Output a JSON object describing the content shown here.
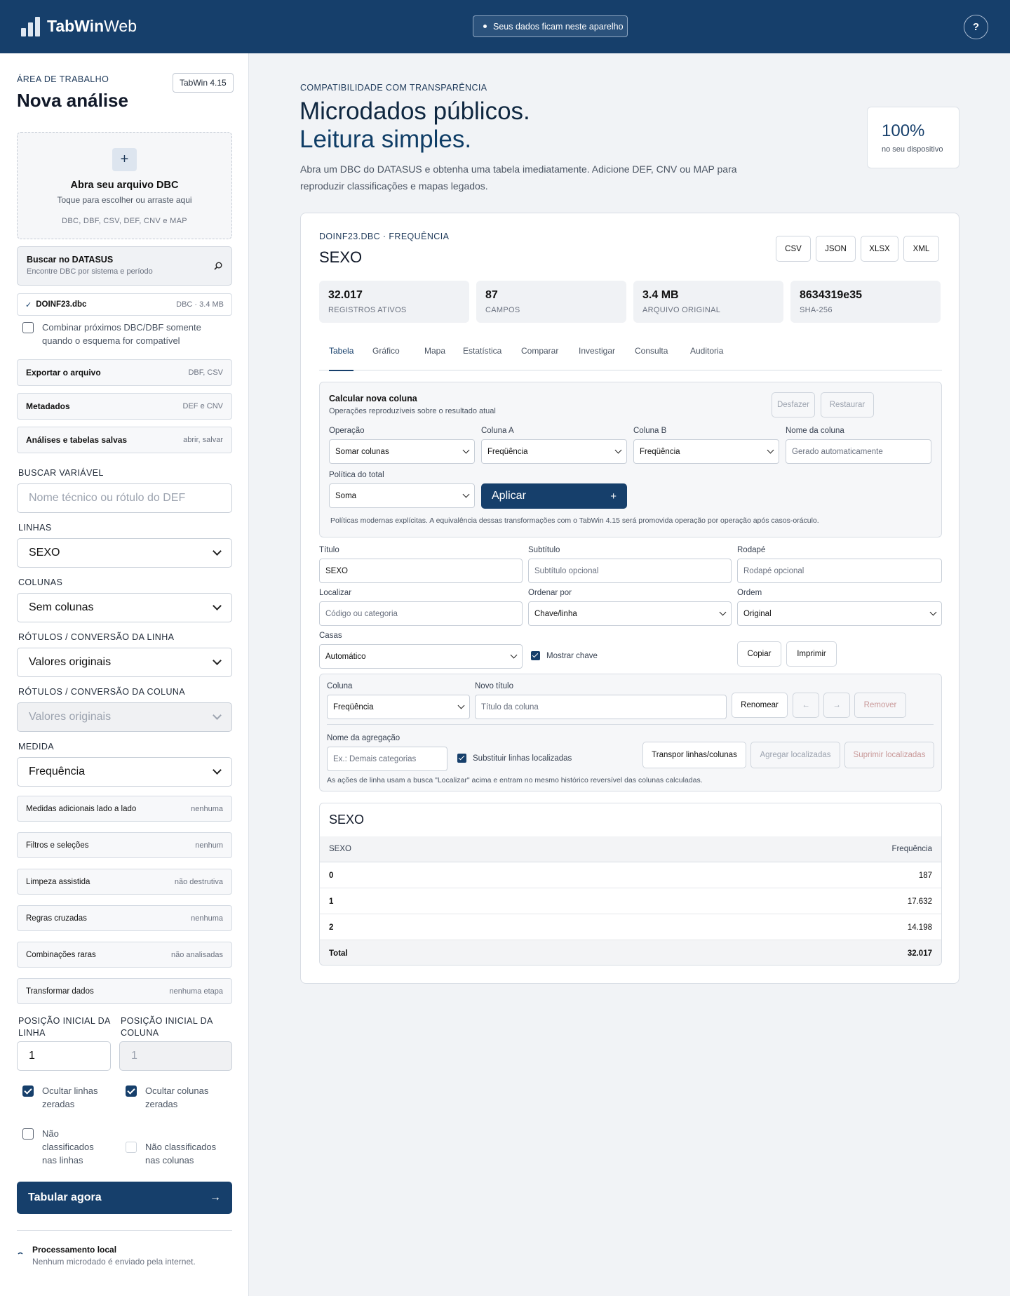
{
  "header": {
    "brand_bold": "TabWin",
    "brand_light": "Web",
    "privacy_text": "Seus dados ficam neste aparelho",
    "help_label": "?"
  },
  "sidebar": {
    "eyebrow": "ÁREA DE TRABALHO",
    "title": "Nova análise",
    "version": "TabWin 4.15",
    "dropzone": {
      "plus": "+",
      "title": "Abra seu arquivo DBC",
      "subtitle": "Toque para escolher ou arraste aqui",
      "formats": "DBC, DBF, CSV, DEF, CNV e MAP"
    },
    "datasus": {
      "title": "Buscar no DATASUS",
      "subtitle": "Encontre DBC por sistema e período"
    },
    "file": {
      "check": "✓",
      "name": "DOINF23.dbc",
      "meta": "DBC · 3.4 MB"
    },
    "combine_label": "Combinar próximos DBC/DBF somente quando o esquema for compatível",
    "sections": [
      {
        "label": "Exportar o arquivo",
        "value": "DBF, CSV"
      },
      {
        "label": "Metadados",
        "value": "DEF e CNV"
      },
      {
        "label": "Análises e tabelas salvas",
        "value": "abrir, salvar"
      }
    ],
    "search_var": {
      "label": "BUSCAR VARIÁVEL",
      "placeholder": "Nome técnico ou rótulo do DEF"
    },
    "rows": {
      "label": "LINHAS",
      "value": "SEXO"
    },
    "cols": {
      "label": "COLUNAS",
      "value": "Sem colunas"
    },
    "row_labels": {
      "label": "RÓTULOS / CONVERSÃO DA LINHA",
      "value": "Valores originais"
    },
    "col_labels": {
      "label": "RÓTULOS / CONVERSÃO DA COLUNA",
      "value": "Valores originais"
    },
    "measure": {
      "label": "MEDIDA",
      "value": "Frequência"
    },
    "extra_sections": [
      {
        "label": "Medidas adicionais lado a lado",
        "value": "nenhuma"
      },
      {
        "label": "Filtros e seleções",
        "value": "nenhum"
      },
      {
        "label": "Limpeza assistida",
        "value": "não destrutiva"
      },
      {
        "label": "Regras cruzadas",
        "value": "nenhuma"
      },
      {
        "label": "Combinações raras",
        "value": "não analisadas"
      },
      {
        "label": "Transformar dados",
        "value": "nenhuma etapa"
      }
    ],
    "start_row": {
      "label": "POSIÇÃO INICIAL DA LINHA",
      "value": "1"
    },
    "start_col": {
      "label": "POSIÇÃO INICIAL DA COLUNA",
      "value": "1"
    },
    "hide_zero_rows": "Ocultar linhas zeradas",
    "hide_zero_cols": "Ocultar colunas zeradas",
    "unclassified_rows": "Não classificados nas linhas",
    "unclassified_cols": "Não classificados nas colunas",
    "tabulate": {
      "label": "Tabular agora",
      "arrow": "→"
    },
    "local": {
      "title": "Processamento local",
      "subtitle": "Nenhum microdado é enviado pela internet."
    }
  },
  "hero": {
    "eyebrow": "COMPATIBILIDADE COM TRANSPARÊNCIA",
    "title_line1": "Microdados públicos.",
    "title_line2": "Leitura simples.",
    "description": "Abra um DBC do DATASUS e obtenha uma tabela imediatamente. Adicione DEF, CNV ou MAP para reproduzir classificações e mapas legados.",
    "stat_value": "100%",
    "stat_label": "no seu dispositivo"
  },
  "result": {
    "eyebrow": "DOINF23.DBC · FREQUÊNCIA",
    "title": "SEXO",
    "exports": [
      "CSV",
      "JSON",
      "XLSX",
      "XML"
    ],
    "stats": [
      {
        "value": "32.017",
        "label": "REGISTROS ATIVOS"
      },
      {
        "value": "87",
        "label": "CAMPOS"
      },
      {
        "value": "3.4 MB",
        "label": "ARQUIVO ORIGINAL"
      },
      {
        "value": "8634319e35",
        "label": "SHA-256"
      }
    ],
    "tabs": [
      "Tabela",
      "Gráfico",
      "Mapa",
      "Estatística",
      "Comparar",
      "Investigar",
      "Consulta",
      "Auditoria"
    ],
    "calc": {
      "title": "Calcular nova coluna",
      "subtitle": "Operações reproduzíveis sobre o resultado atual",
      "undo": "Desfazer",
      "restore": "Restaurar",
      "op_label": "Operação",
      "op_value": "Somar colunas",
      "cola_label": "Coluna A",
      "cola_value": "Freqüência",
      "colb_label": "Coluna B",
      "colb_value": "Freqüência",
      "name_label": "Nome da coluna",
      "name_placeholder": "Gerado automaticamente",
      "policy_label": "Política do total",
      "policy_value": "Soma",
      "apply": "Aplicar",
      "apply_plus": "+",
      "note": "Políticas modernas explícitas. A equivalência dessas transformações com o TabWin 4.15 será promovida operação por operação após casos-oráculo."
    },
    "fmt": {
      "title_label": "Título",
      "title_value": "SEXO",
      "subtitle_label": "Subtítulo",
      "subtitle_placeholder": "Subtítulo opcional",
      "footer_label": "Rodapé",
      "footer_placeholder": "Rodapé opcional",
      "find_label": "Localizar",
      "find_placeholder": "Código ou categoria",
      "sort_label": "Ordenar por",
      "sort_value": "Chave/linha",
      "order_label": "Ordem",
      "order_value": "Original",
      "decimals_label": "Casas",
      "decimals_value": "Automático",
      "show_key": "Mostrar chave",
      "copy": "Copiar",
      "print": "Imprimir"
    },
    "cols": {
      "col_label": "Coluna",
      "col_value": "Freqüência",
      "newtitle_label": "Novo título",
      "newtitle_placeholder": "Título da coluna",
      "rename": "Renomear",
      "left": "←",
      "right": "→",
      "remove": "Remover",
      "agg_label": "Nome da agregação",
      "agg_placeholder": "Ex.: Demais categorias",
      "replace_rows": "Substituir linhas localizadas",
      "transpose": "Transpor linhas/colunas",
      "aggregate": "Agregar localizadas",
      "suppress": "Suprimir localizadas",
      "note": "As ações de linha usam a busca \"Localizar\" acima e entram no mesmo histórico reversível das colunas calculadas."
    },
    "table": {
      "title": "SEXO",
      "head_key": "SEXO",
      "head_val": "Frequência",
      "rows": [
        {
          "key": "0",
          "value": "187"
        },
        {
          "key": "1",
          "value": "17.632"
        },
        {
          "key": "2",
          "value": "14.198"
        }
      ],
      "total_label": "Total",
      "total_value": "32.017"
    }
  }
}
